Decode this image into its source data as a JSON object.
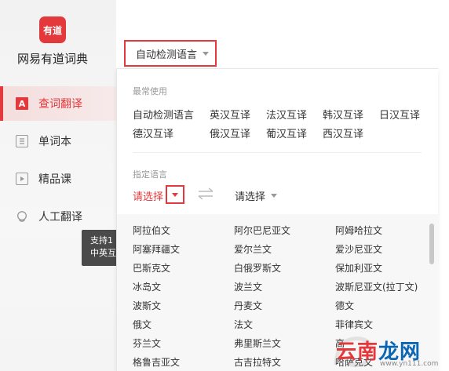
{
  "app": {
    "logo_text": "有道",
    "name": "网易有道词典"
  },
  "sidebar": {
    "items": [
      {
        "label": "查词翻译",
        "icon": "translate-a-icon",
        "active": true
      },
      {
        "label": "单词本",
        "icon": "wordbook-icon",
        "active": false
      },
      {
        "label": "精品课",
        "icon": "course-play-icon",
        "active": false
      },
      {
        "label": "人工翻译",
        "icon": "human-translate-icon",
        "active": false
      }
    ],
    "tooltip": {
      "line1": "支持1",
      "line2": "中英互"
    }
  },
  "top_select": {
    "value": "自动检测语言"
  },
  "panel": {
    "common_title": "最常使用",
    "common": [
      "自动检测语言",
      "英汉互译",
      "法汉互译",
      "韩汉互译",
      "日汉互译",
      "德汉互译",
      "俄汉互译",
      "葡汉互译",
      "西汉互译"
    ],
    "specify_title": "指定语言",
    "source_select": "请选择",
    "target_select": "请选择",
    "languages": [
      [
        "阿拉伯文",
        "阿尔巴尼亚文",
        "阿姆哈拉文"
      ],
      [
        "阿塞拜疆文",
        "爱尔兰文",
        "爱沙尼亚文"
      ],
      [
        "巴斯克文",
        "白俄罗斯文",
        "保加利亚文"
      ],
      [
        "冰岛文",
        "波兰文",
        "波斯尼亚文(拉丁文)"
      ],
      [
        "波斯文",
        "丹麦文",
        "德文"
      ],
      [
        "俄文",
        "法文",
        "菲律宾文"
      ],
      [
        "芬兰文",
        "弗里斯兰文",
        "高"
      ],
      [
        "格鲁吉亚文",
        "古吉拉特文",
        "哈萨克文"
      ]
    ]
  },
  "watermark": {
    "text_a": "云南",
    "text_b": "龙网",
    "url": "www.yn111.com"
  },
  "colors": {
    "accent": "#e4393c"
  }
}
